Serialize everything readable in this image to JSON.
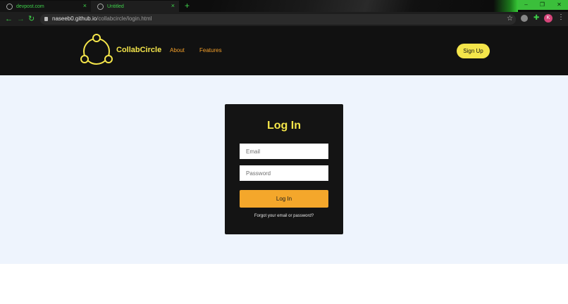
{
  "browser": {
    "tabs": [
      {
        "title": "devpost.com",
        "close": "×"
      },
      {
        "title": "Untitled",
        "close": "×"
      }
    ],
    "new_tab": "+",
    "window_controls": {
      "minimize": "–",
      "maximize": "❐",
      "close": "✕"
    },
    "nav": {
      "back": "←",
      "forward": "→",
      "reload": "↻"
    },
    "url_host": "naseeb0.github.io",
    "url_path": "/collabcircle/login.html",
    "bookmark": "☆",
    "extensions_icon": "✚",
    "profile_initial": "K",
    "menu": "⋮"
  },
  "header": {
    "brand": "CollabCircle",
    "nav": [
      {
        "label": "About"
      },
      {
        "label": "Features"
      }
    ],
    "signup_label": "Sign Up"
  },
  "login": {
    "title": "Log In",
    "email_placeholder": "Email",
    "password_placeholder": "Password",
    "submit_label": "Log In",
    "forgot_label": "Forgot your email or password?"
  },
  "colors": {
    "accent_yellow": "#f4e54a",
    "accent_orange": "#f5a02a",
    "header_bg": "#111111",
    "page_bg": "#eef4fd",
    "card_bg": "#141414"
  }
}
